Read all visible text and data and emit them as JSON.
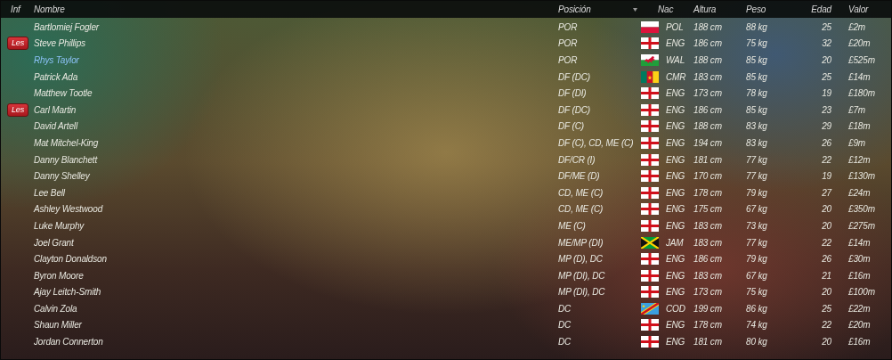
{
  "columns": [
    {
      "label": "Inf",
      "sorted": false
    },
    {
      "label": "Nombre",
      "sorted": false
    },
    {
      "label": "Posición",
      "sorted": true
    },
    {
      "label": "Nac",
      "sorted": false
    },
    {
      "label": "Altura",
      "sorted": false
    },
    {
      "label": "Peso",
      "sorted": false
    },
    {
      "label": "Edad",
      "sorted": false
    },
    {
      "label": "Valor",
      "sorted": false
    }
  ],
  "rows": [
    {
      "name": "Bartlomiej Fogler",
      "highlighted": false,
      "position": "POR",
      "kind": "poland",
      "nation": "POL",
      "height": "188 cm",
      "weight": "88 kg",
      "age": "25",
      "value": "£2m"
    },
    {
      "status": "Les",
      "name": "Steve Phillips",
      "highlighted": false,
      "position": "POR",
      "kind": "england",
      "nation": "ENG",
      "height": "186 cm",
      "weight": "75 kg",
      "age": "32",
      "value": "£20m"
    },
    {
      "name": "Rhys Taylor",
      "highlighted": true,
      "position": "POR",
      "kind": "wales",
      "nation": "WAL",
      "height": "188 cm",
      "weight": "85 kg",
      "age": "20",
      "value": "£525m"
    },
    {
      "name": "Patrick Ada",
      "highlighted": false,
      "position": "DF (DC)",
      "kind": "cameroon",
      "nation": "CMR",
      "height": "183 cm",
      "weight": "85 kg",
      "age": "25",
      "value": "£14m"
    },
    {
      "name": "Matthew Tootle",
      "highlighted": false,
      "position": "DF (DI)",
      "kind": "england",
      "nation": "ENG",
      "height": "173 cm",
      "weight": "78 kg",
      "age": "19",
      "value": "£180m"
    },
    {
      "status": "Les",
      "name": "Carl Martin",
      "highlighted": false,
      "position": "DF (DC)",
      "kind": "england",
      "nation": "ENG",
      "height": "186 cm",
      "weight": "85 kg",
      "age": "23",
      "value": "£7m"
    },
    {
      "name": "David Artell",
      "highlighted": false,
      "position": "DF (C)",
      "kind": "england",
      "nation": "ENG",
      "height": "188 cm",
      "weight": "83 kg",
      "age": "29",
      "value": "£18m"
    },
    {
      "name": "Mat Mitchel-King",
      "highlighted": false,
      "position": "DF (C), CD, ME (C)",
      "kind": "england",
      "nation": "ENG",
      "height": "194 cm",
      "weight": "83 kg",
      "age": "26",
      "value": "£9m"
    },
    {
      "name": "Danny Blanchett",
      "highlighted": false,
      "position": "DF/CR (I)",
      "kind": "england",
      "nation": "ENG",
      "height": "181 cm",
      "weight": "77 kg",
      "age": "22",
      "value": "£12m"
    },
    {
      "name": "Danny Shelley",
      "highlighted": false,
      "position": "DF/ME (D)",
      "kind": "england",
      "nation": "ENG",
      "height": "170 cm",
      "weight": "77 kg",
      "age": "19",
      "value": "£130m"
    },
    {
      "name": "Lee Bell",
      "highlighted": false,
      "position": "CD, ME (C)",
      "kind": "england",
      "nation": "ENG",
      "height": "178 cm",
      "weight": "79 kg",
      "age": "27",
      "value": "£24m"
    },
    {
      "name": "Ashley Westwood",
      "highlighted": false,
      "position": "CD, ME (C)",
      "kind": "england",
      "nation": "ENG",
      "height": "175 cm",
      "weight": "67 kg",
      "age": "20",
      "value": "£350m"
    },
    {
      "name": "Luke Murphy",
      "highlighted": false,
      "position": "ME (C)",
      "kind": "england",
      "nation": "ENG",
      "height": "183 cm",
      "weight": "73 kg",
      "age": "20",
      "value": "£275m"
    },
    {
      "name": "Joel Grant",
      "highlighted": false,
      "position": "ME/MP (DI)",
      "kind": "jamaica",
      "nation": "JAM",
      "height": "183 cm",
      "weight": "77 kg",
      "age": "22",
      "value": "£14m"
    },
    {
      "name": "Clayton Donaldson",
      "highlighted": false,
      "position": "MP (D), DC",
      "kind": "england",
      "nation": "ENG",
      "height": "186 cm",
      "weight": "79 kg",
      "age": "26",
      "value": "£30m"
    },
    {
      "name": "Byron Moore",
      "highlighted": false,
      "position": "MP (DI), DC",
      "kind": "england",
      "nation": "ENG",
      "height": "183 cm",
      "weight": "67 kg",
      "age": "21",
      "value": "£16m"
    },
    {
      "name": "Ajay Leitch-Smith",
      "highlighted": false,
      "position": "MP (DI), DC",
      "kind": "england",
      "nation": "ENG",
      "height": "173 cm",
      "weight": "75 kg",
      "age": "20",
      "value": "£100m"
    },
    {
      "name": "Calvin Zola",
      "highlighted": false,
      "position": "DC",
      "kind": "drcongo",
      "nation": "COD",
      "height": "199 cm",
      "weight": "86 kg",
      "age": "25",
      "value": "£22m"
    },
    {
      "name": "Shaun Miller",
      "highlighted": false,
      "position": "DC",
      "kind": "england",
      "nation": "ENG",
      "height": "178 cm",
      "weight": "74 kg",
      "age": "22",
      "value": "£20m"
    },
    {
      "name": "Jordan Connerton",
      "highlighted": false,
      "position": "DC",
      "kind": "england",
      "nation": "ENG",
      "height": "181 cm",
      "weight": "80 kg",
      "age": "20",
      "value": "£16m"
    }
  ]
}
